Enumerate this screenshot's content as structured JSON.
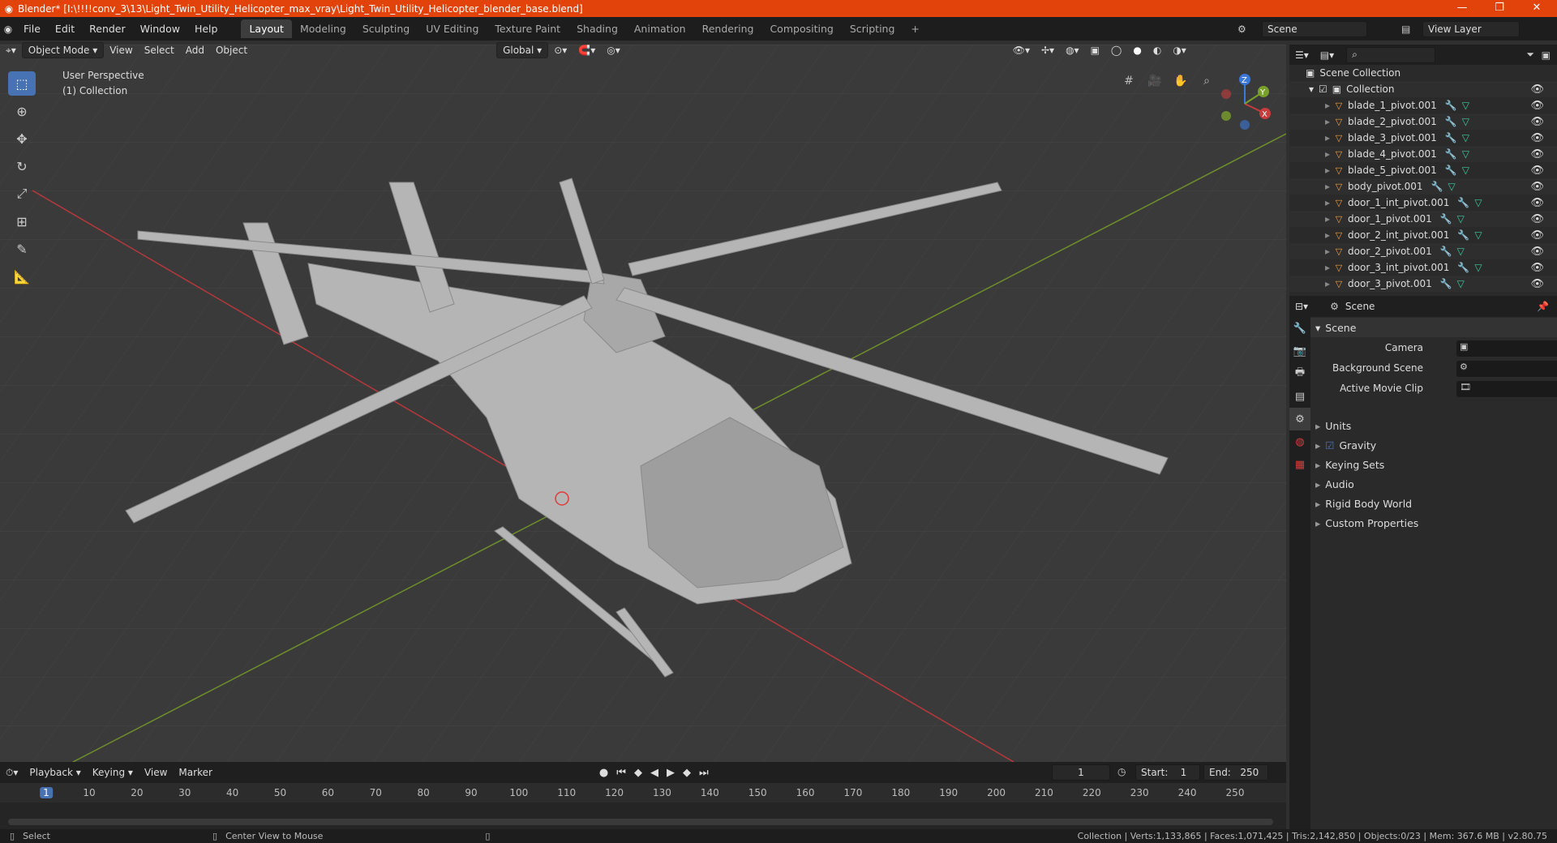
{
  "titlebar": {
    "title": "Blender* [I:\\!!!!conv_3\\13\\Light_Twin_Utility_Helicopter_max_vray\\Light_Twin_Utility_Helicopter_blender_base.blend]",
    "minimize": "—",
    "maximize": "❐",
    "close": "✕"
  },
  "menu": {
    "items": [
      "File",
      "Edit",
      "Render",
      "Window",
      "Help"
    ]
  },
  "workspaces": {
    "tabs": [
      "Layout",
      "Modeling",
      "Sculpting",
      "UV Editing",
      "Texture Paint",
      "Shading",
      "Animation",
      "Rendering",
      "Compositing",
      "Scripting"
    ],
    "add": "+"
  },
  "scene_selector": {
    "value": "Scene"
  },
  "viewlayer_selector": {
    "value": "View Layer"
  },
  "viewport_header": {
    "mode": "Object Mode",
    "menus": [
      "View",
      "Select",
      "Add",
      "Object"
    ],
    "transform_orientation": "Global"
  },
  "viewport": {
    "perspective_label": "User Perspective",
    "collection_label": "(1) Collection",
    "axis_labels": {
      "x": "X",
      "y": "Y",
      "z": "Z"
    }
  },
  "outliner": {
    "scene_collection": "Scene Collection",
    "collection": "Collection",
    "items": [
      "blade_1_pivot.001",
      "blade_2_pivot.001",
      "blade_3_pivot.001",
      "blade_4_pivot.001",
      "blade_5_pivot.001",
      "body_pivot.001",
      "door_1_int_pivot.001",
      "door_1_pivot.001",
      "door_2_int_pivot.001",
      "door_2_pivot.001",
      "door_3_int_pivot.001",
      "door_3_pivot.001"
    ]
  },
  "properties": {
    "context": "Scene",
    "section": "Scene",
    "camera_label": "Camera",
    "background_scene_label": "Background Scene",
    "active_movie_clip_label": "Active Movie Clip",
    "subsections": [
      "Units",
      "Gravity",
      "Keying Sets",
      "Audio",
      "Rigid Body World",
      "Custom Properties"
    ]
  },
  "timeline": {
    "menus": [
      "Playback",
      "Keying",
      "View",
      "Marker"
    ],
    "current_frame": "1",
    "start_label": "Start:",
    "start": "1",
    "end_label": "End:",
    "end": "250",
    "ruler": [
      "1",
      "10",
      "20",
      "30",
      "40",
      "50",
      "60",
      "70",
      "80",
      "90",
      "100",
      "110",
      "120",
      "130",
      "140",
      "150",
      "160",
      "170",
      "180",
      "190",
      "200",
      "210",
      "220",
      "230",
      "240",
      "250"
    ]
  },
  "statusbar": {
    "left": "Select",
    "middle": "Center View to Mouse",
    "right": "Collection | Verts:1,133,865 | Faces:1,071,425 | Tris:2,142,850 | Objects:0/23 | Mem: 367.6 MB | v2.80.75"
  },
  "colors": {
    "titlebar": "#e2430a",
    "accent": "#4772b3",
    "x_axis": "#c83c3c",
    "y_axis": "#7aa02c",
    "z_axis": "#3c78d8"
  }
}
